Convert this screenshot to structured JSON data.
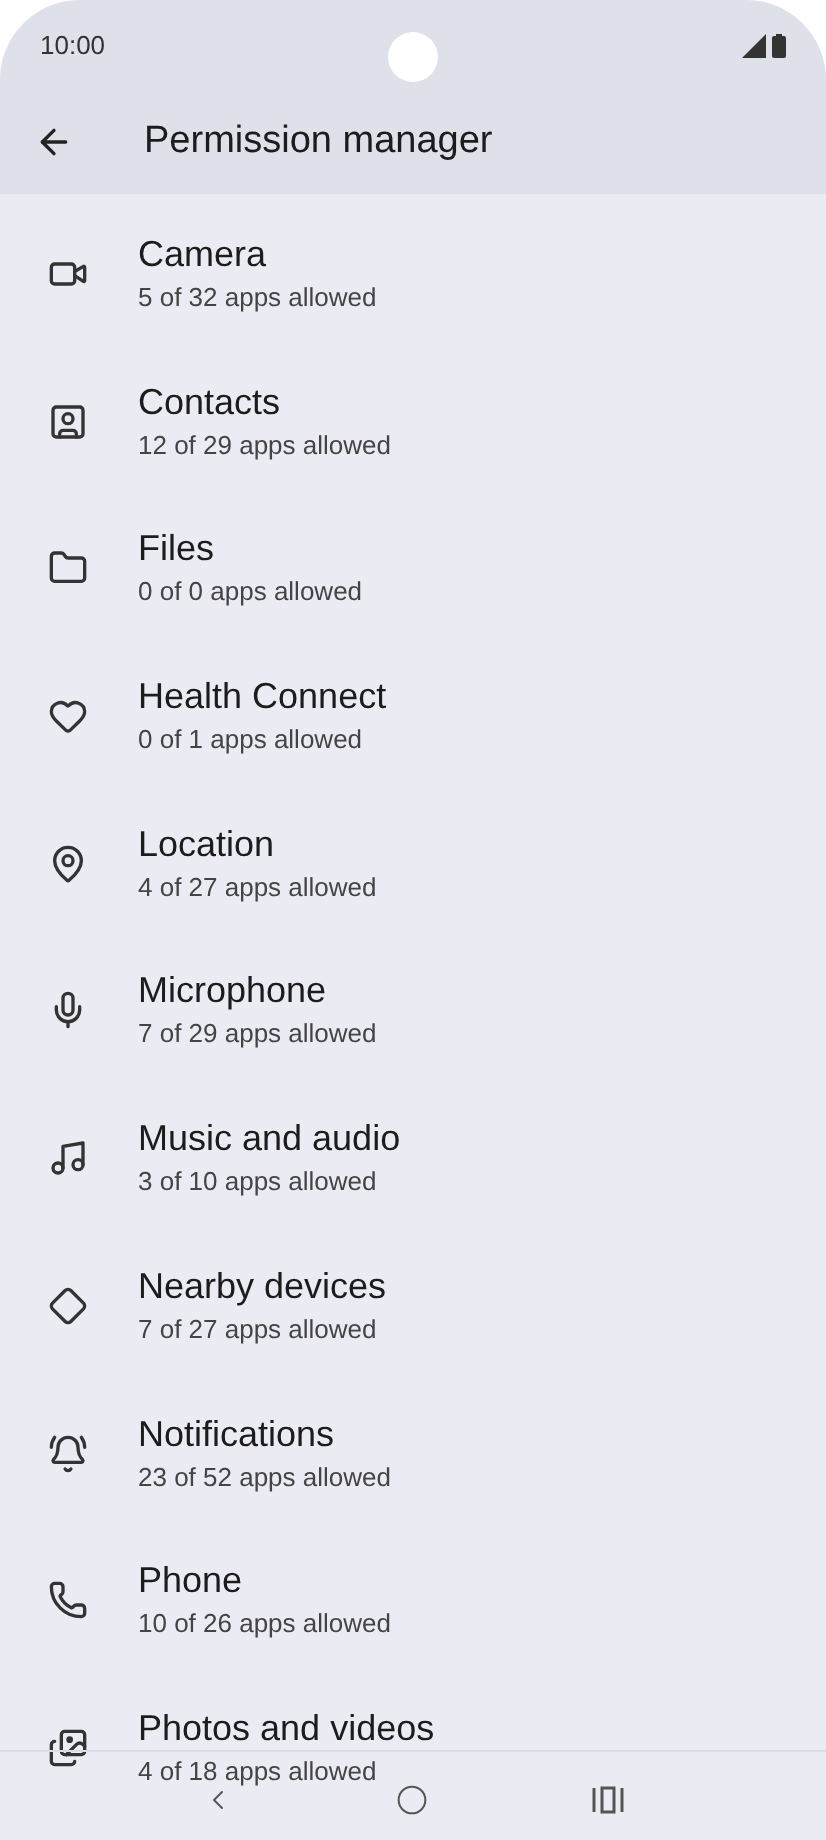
{
  "status_bar": {
    "time": "10:00"
  },
  "header": {
    "title": "Permission manager"
  },
  "permissions": [
    {
      "name": "Camera",
      "summary": "5 of 32 apps allowed"
    },
    {
      "name": "Contacts",
      "summary": "12 of 29 apps allowed"
    },
    {
      "name": "Files",
      "summary": "0 of 0 apps allowed"
    },
    {
      "name": "Health Connect",
      "summary": "0 of 1 apps allowed"
    },
    {
      "name": "Location",
      "summary": "4 of 27 apps allowed"
    },
    {
      "name": "Microphone",
      "summary": "7 of 29 apps allowed"
    },
    {
      "name": "Music and audio",
      "summary": "3 of 10 apps allowed"
    },
    {
      "name": "Nearby devices",
      "summary": "7 of 27 apps allowed"
    },
    {
      "name": "Notifications",
      "summary": "23 of 52 apps allowed"
    },
    {
      "name": "Phone",
      "summary": "10 of 26 apps allowed"
    },
    {
      "name": "Photos and videos",
      "summary": "4 of 18 apps allowed"
    }
  ]
}
